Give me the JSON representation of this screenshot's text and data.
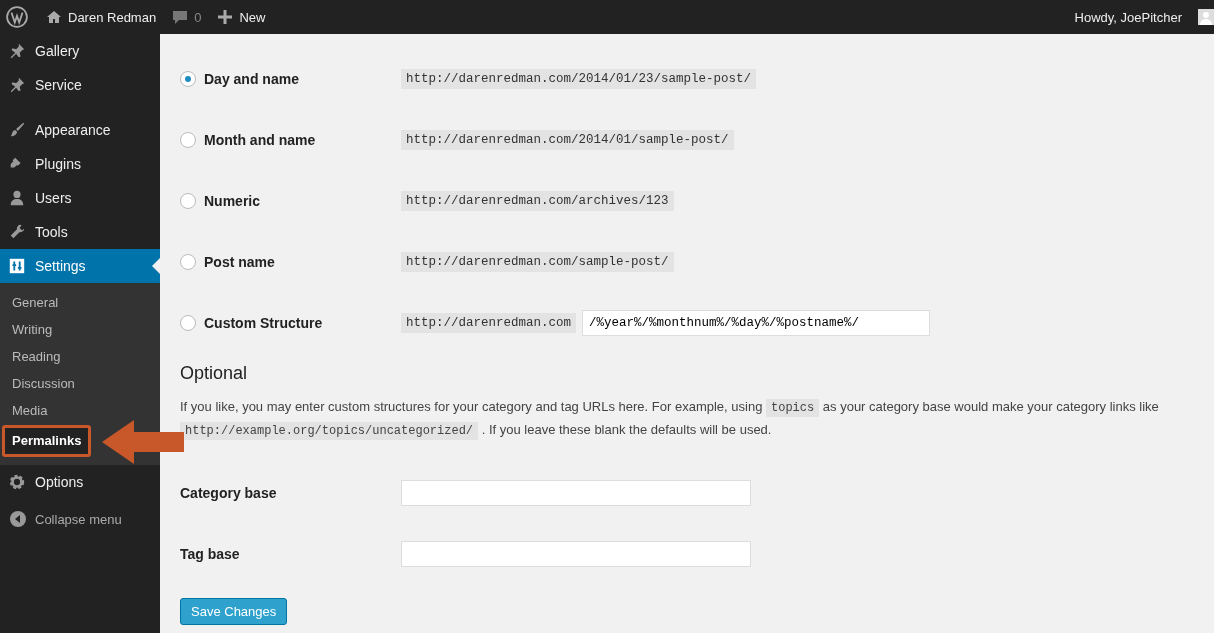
{
  "admin_bar": {
    "site_name": "Daren Redman",
    "comments_count": "0",
    "new_label": "New",
    "greeting": "Howdy, JoePitcher"
  },
  "sidebar": {
    "items": [
      {
        "label": "Gallery",
        "selected": false
      },
      {
        "label": "Service",
        "selected": false
      },
      {
        "label": "Appearance",
        "selected": false
      },
      {
        "label": "Plugins",
        "selected": false
      },
      {
        "label": "Users",
        "selected": false
      },
      {
        "label": "Tools",
        "selected": false
      },
      {
        "label": "Settings",
        "selected": true
      }
    ],
    "submenu": [
      {
        "label": "General",
        "selected": false,
        "annotated": false
      },
      {
        "label": "Writing",
        "selected": false,
        "annotated": false
      },
      {
        "label": "Reading",
        "selected": false,
        "annotated": false
      },
      {
        "label": "Discussion",
        "selected": false,
        "annotated": false
      },
      {
        "label": "Media",
        "selected": false,
        "annotated": false
      },
      {
        "label": "Permalinks",
        "selected": true,
        "annotated": true
      }
    ],
    "after_items": [
      {
        "label": "Options",
        "selected": false
      }
    ],
    "collapse_label": "Collapse menu"
  },
  "permalink_options": [
    {
      "label": "Day and name",
      "selected": true,
      "example": "http://darenredman.com/2014/01/23/sample-post/"
    },
    {
      "label": "Month and name",
      "selected": false,
      "example": "http://darenredman.com/2014/01/sample-post/"
    },
    {
      "label": "Numeric",
      "selected": false,
      "example": "http://darenredman.com/archives/123"
    },
    {
      "label": "Post name",
      "selected": false,
      "example": "http://darenredman.com/sample-post/"
    },
    {
      "label": "Custom Structure",
      "selected": false,
      "example": "http://darenredman.com",
      "value": "/%year%/%monthnum%/%day%/%postname%/"
    }
  ],
  "optional": {
    "heading": "Optional",
    "description": [
      {
        "kind": "text",
        "text": "If you like, you may enter custom structures for your category and tag URLs here. For example, using "
      },
      {
        "kind": "code",
        "text": "topics"
      },
      {
        "kind": "text",
        "text": " as your category base would make your category links like "
      },
      {
        "kind": "code",
        "text": "http://example.org/topics/uncategorized/"
      },
      {
        "kind": "text",
        "text": " . If you leave these blank the defaults will be used."
      }
    ],
    "fields": [
      {
        "label": "Category base"
      },
      {
        "label": "Tag base"
      }
    ]
  },
  "save_button": "Save Changes"
}
